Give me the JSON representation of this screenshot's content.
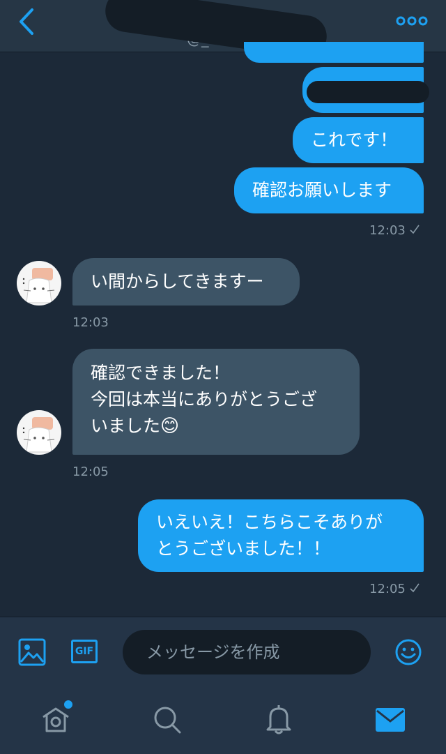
{
  "header": {
    "handle": "@_",
    "colors": {
      "accent": "#1da1f2",
      "background": "#1c2938",
      "header": "#263645"
    }
  },
  "messages": [
    {
      "direction": "outgoing",
      "text": "これです！"
    },
    {
      "direction": "outgoing",
      "text": "確認お願いします"
    },
    {
      "direction": "outgoing",
      "time": "12:03",
      "status_icon": "check-icon"
    },
    {
      "direction": "incoming",
      "text": "い間からしてきますー",
      "time": "12:03"
    },
    {
      "direction": "incoming",
      "line1": "確認できました！",
      "line2": "今回は本当にありがとうござ",
      "line3": "いました",
      "emoji": "😊",
      "time": "12:05"
    },
    {
      "direction": "outgoing",
      "line1": "いえいえ！こちらこそありが",
      "line2": "とうございました！！",
      "time": "12:05",
      "status_icon": "check-icon"
    }
  ],
  "composer": {
    "placeholder": "メッセージを作成",
    "icons": [
      "image-icon",
      "gif-icon",
      "emoji-icon"
    ],
    "gif_label": "GIF"
  },
  "tabbar": {
    "items": [
      "home-icon",
      "search-icon",
      "notifications-icon",
      "messages-icon"
    ],
    "active": "messages-icon",
    "home_has_notification_dot": true
  }
}
